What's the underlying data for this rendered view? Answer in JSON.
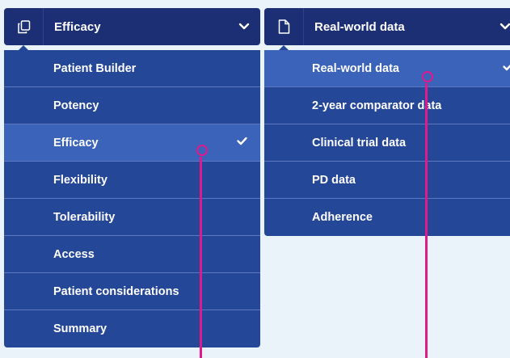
{
  "left_dropdown": {
    "selected": "Efficacy",
    "header_icon": "copy-pages-icon",
    "items": [
      {
        "label": "Patient Builder"
      },
      {
        "label": "Potency"
      },
      {
        "label": "Efficacy"
      },
      {
        "label": "Flexibility"
      },
      {
        "label": "Tolerability"
      },
      {
        "label": "Access"
      },
      {
        "label": "Patient considerations"
      },
      {
        "label": "Summary"
      }
    ],
    "selected_index": 2
  },
  "right_dropdown": {
    "selected": "Real-world data",
    "header_icon": "document-icon",
    "items": [
      {
        "label": "Real-world data"
      },
      {
        "label": "2-year comparator data"
      },
      {
        "label": "Clinical trial data"
      },
      {
        "label": "PD data"
      },
      {
        "label": "Adherence"
      }
    ],
    "selected_index": 0
  },
  "colors": {
    "header_bg": "#1d2f74",
    "menu_bg": "#254798",
    "selected_bg": "#3a63b9",
    "pointer": "#e0198c",
    "page_bg": "#e9f3f9"
  }
}
